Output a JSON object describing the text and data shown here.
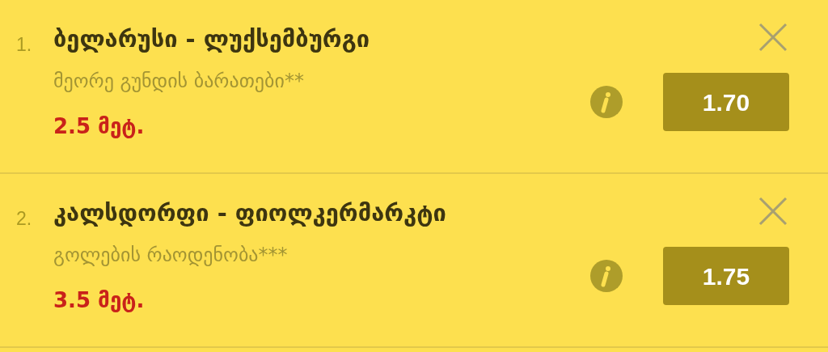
{
  "bets": [
    {
      "number": "1.",
      "match": "ბელარუსი - ლუქსემბურგი",
      "market": "მეორე გუნდის ბარათები**",
      "selection": "2.5 მეტ.",
      "odds": "1.70"
    },
    {
      "number": "2.",
      "match": "კალსდორფი - ფიოლკერმარკტი",
      "market": "გოლების რაოდენობა***",
      "selection": "3.5 მეტ.",
      "odds": "1.75"
    }
  ]
}
